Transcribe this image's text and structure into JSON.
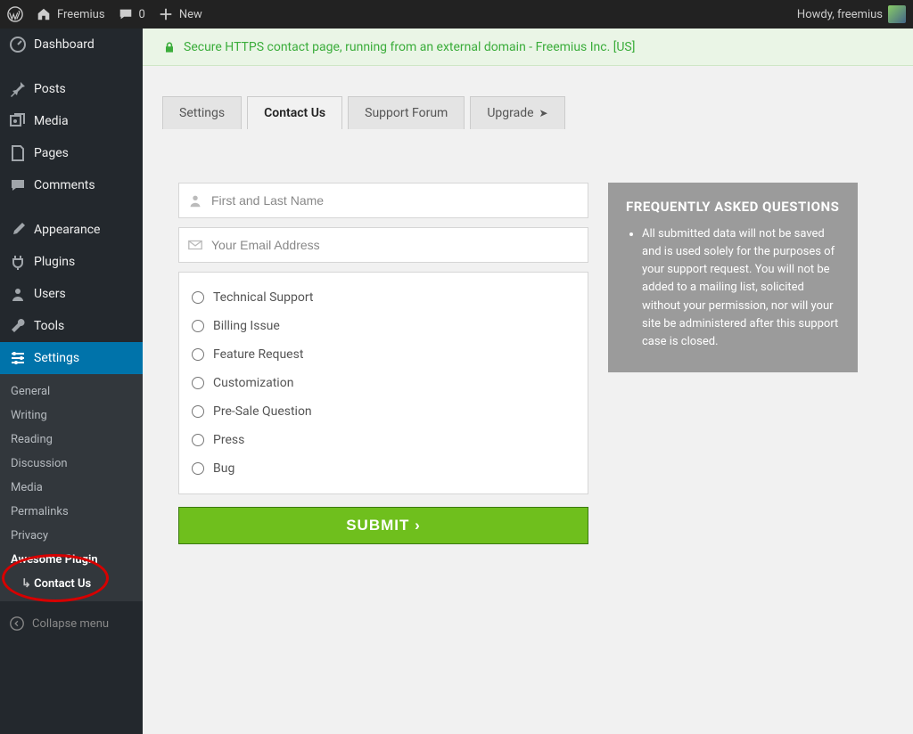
{
  "adminBar": {
    "siteName": "Freemius",
    "commentCount": "0",
    "newLabel": "New",
    "howdy": "Howdy, freemius"
  },
  "sidebar": {
    "items": [
      {
        "label": "Dashboard"
      },
      {
        "label": "Posts"
      },
      {
        "label": "Media"
      },
      {
        "label": "Pages"
      },
      {
        "label": "Comments"
      },
      {
        "label": "Appearance"
      },
      {
        "label": "Plugins"
      },
      {
        "label": "Users"
      },
      {
        "label": "Tools"
      },
      {
        "label": "Settings"
      }
    ],
    "submenu": [
      {
        "label": "General"
      },
      {
        "label": "Writing"
      },
      {
        "label": "Reading"
      },
      {
        "label": "Discussion"
      },
      {
        "label": "Media"
      },
      {
        "label": "Permalinks"
      },
      {
        "label": "Privacy"
      },
      {
        "label": "Awesome Plugin"
      },
      {
        "label": "Contact Us"
      }
    ],
    "collapseLabel": "Collapse menu"
  },
  "secureBar": {
    "text": "Secure HTTPS contact page, running from an external domain - Freemius Inc. [US]"
  },
  "tabs": {
    "settings": "Settings",
    "contact": "Contact Us",
    "forum": "Support Forum",
    "upgrade": "Upgrade"
  },
  "form": {
    "namePlaceholder": "First and Last Name",
    "emailPlaceholder": "Your Email Address",
    "options": [
      "Technical Support",
      "Billing Issue",
      "Feature Request",
      "Customization",
      "Pre-Sale Question",
      "Press",
      "Bug"
    ],
    "submitLabel": "SUBMIT ›"
  },
  "faq": {
    "title": "FREQUENTLY ASKED QUESTIONS",
    "body": "All submitted data will not be saved and is used solely for the purposes of your support request. You will not be added to a mailing list, solicited without your permission, nor will your site be administered after this support case is closed."
  }
}
